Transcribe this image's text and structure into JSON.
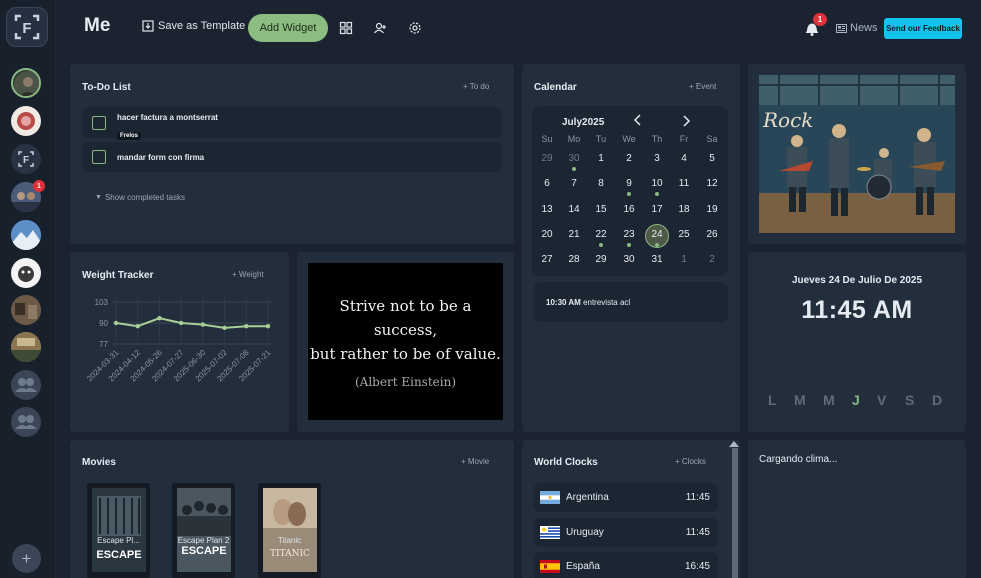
{
  "topbar": {
    "title": "Me",
    "save_template": "Save as Template",
    "add_widget": "Add Widget",
    "notif_count": "1",
    "news": "News",
    "feedback": "Send our Feedback"
  },
  "sidebar": {
    "logo": "F",
    "badge": "1"
  },
  "todo": {
    "title": "To-Do List",
    "action": "+ To do",
    "items": [
      {
        "text": "hacer factura a montserrat",
        "tag": "Frelos"
      },
      {
        "text": "mandar form con firma",
        "tag": ""
      }
    ],
    "show_completed": "Show completed tasks"
  },
  "calendar": {
    "title": "Calendar",
    "action": "+ Event",
    "month": "July2025",
    "weekdays": [
      "Su",
      "Mo",
      "Tu",
      "We",
      "Th",
      "Fr",
      "Sa"
    ],
    "weeks": [
      [
        "29",
        "30",
        "1",
        "2",
        "3",
        "4",
        "5"
      ],
      [
        "6",
        "7",
        "8",
        "9",
        "10",
        "11",
        "12"
      ],
      [
        "13",
        "14",
        "15",
        "16",
        "17",
        "18",
        "19"
      ],
      [
        "20",
        "21",
        "22",
        "23",
        "24",
        "25",
        "26"
      ],
      [
        "27",
        "28",
        "29",
        "30",
        "31",
        "1",
        "2"
      ]
    ],
    "event_time": "10:30 AM",
    "event_text": "entrevista acl"
  },
  "weight": {
    "title": "Weight Tracker",
    "action": "+ Weight",
    "y_ticks": [
      "103",
      "90",
      "77"
    ],
    "x_labels": [
      "2024-03-31",
      "2024-04-12",
      "2024-05-26",
      "2024-07-27",
      "2025-06-30",
      "2025-07-02",
      "2025-07-08",
      "2025-07-21"
    ],
    "values": [
      90,
      88,
      93,
      90,
      89,
      87,
      88,
      88
    ],
    "ylim": [
      77,
      103
    ],
    "line_color": "#a9cf98"
  },
  "quote": {
    "line1": "Strive not to be a success,",
    "line2": "but rather to be of value.",
    "author": "(Albert Einstein)"
  },
  "datetime": {
    "date": "Jueves 24 De Julio De 2025",
    "time": "11:45 AM",
    "weekdays": [
      "L",
      "M",
      "M",
      "J",
      "V",
      "S",
      "D"
    ],
    "active_color": "#8ab883"
  },
  "movies": {
    "title": "Movies",
    "action": "+ Movie",
    "items": [
      {
        "title": "Escape Pl...",
        "poster": "ESCAPE"
      },
      {
        "title": "Escape Plan 2",
        "poster": "ESCAPE"
      },
      {
        "title": "Titanic",
        "poster": "TITANIC"
      }
    ]
  },
  "world_clocks": {
    "title": "World Clocks",
    "action": "+ Clocks",
    "rows": [
      {
        "name": "Argentina",
        "time": "11:45"
      },
      {
        "name": "Uruguay",
        "time": "11:45"
      },
      {
        "name": "España",
        "time": "16:45"
      }
    ]
  },
  "weather": {
    "loading": "Cargando clima..."
  }
}
